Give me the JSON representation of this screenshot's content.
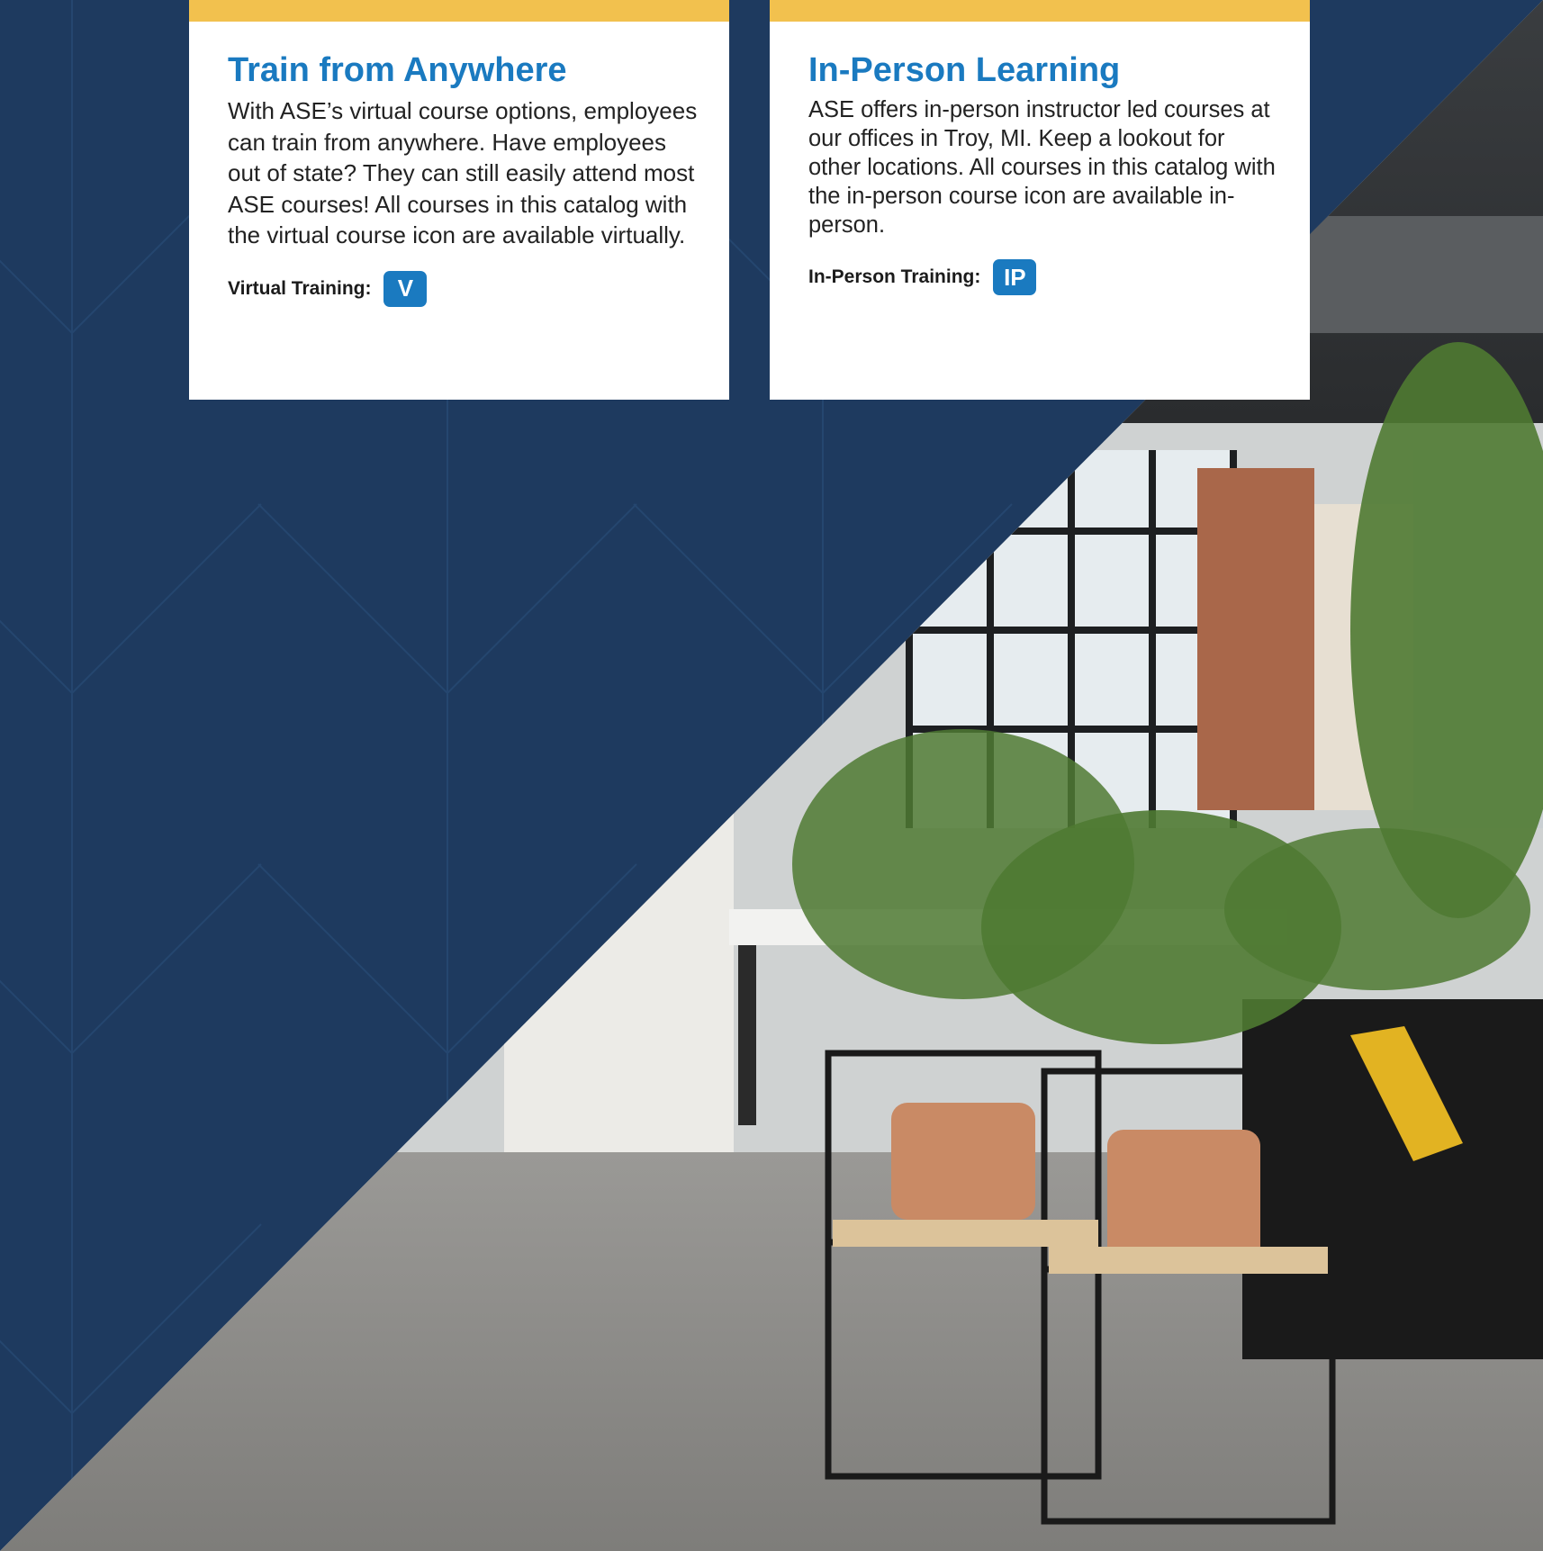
{
  "cards": {
    "virtual": {
      "title": "Train from Anywhere",
      "text": "With ASE’s virtual course options, employees can train from anywhere. Have employees out of state? They can still easily attend most ASE courses! All courses in this catalog with the virtual course icon are available virtually.",
      "badge_label": "Virtual Training:",
      "badge_text": "V"
    },
    "inperson": {
      "title": "In-Person Learning",
      "text": "ASE offers in-person instructor led courses at our offices in Troy, MI. Keep a lookout for other locations. All courses in this catalog with the in-person course icon are available in-person.",
      "badge_label": "In-Person Training:",
      "badge_text": "IP"
    }
  },
  "colors": {
    "navy": "#1e3a5f",
    "accent_yellow": "#f2c14e",
    "title_blue": "#1a7ac0"
  }
}
